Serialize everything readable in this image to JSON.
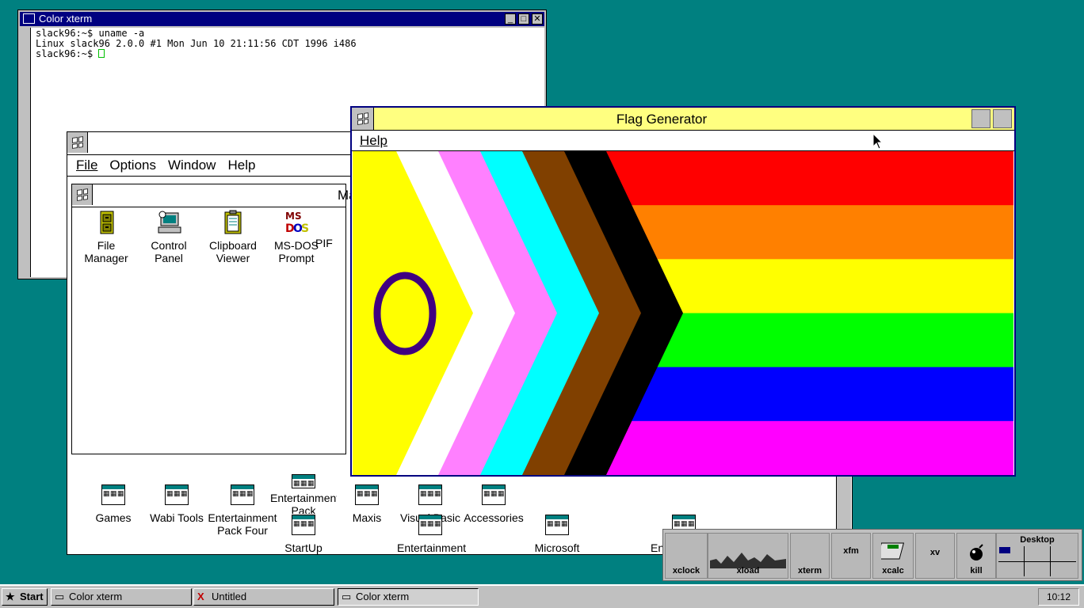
{
  "xterm": {
    "title": "Color xterm",
    "lines": [
      "slack96:~$ uname -a",
      "Linux slack96 2.0.0 #1 Mon Jun 10 21:11:56 CDT 1996 i486"
    ],
    "prompt": "slack96:~$ "
  },
  "progman": {
    "menu": {
      "file": "File",
      "options": "Options",
      "window": "Window",
      "help": "Help"
    },
    "main_title": "Ma",
    "main_icons": [
      {
        "label1": "File",
        "label2": "Manager"
      },
      {
        "label1": "Control",
        "label2": "Panel"
      },
      {
        "label1": "Clipboard",
        "label2": "Viewer"
      },
      {
        "label1": "MS-DOS",
        "label2": "Prompt"
      },
      {
        "label1": "PIF",
        "label2": ""
      }
    ],
    "groups": [
      "Games",
      "Wabi Tools",
      "Entertainment Pack Four",
      "Entertainment Pack",
      "Maxis",
      "Visual Basic",
      "Accessories",
      "StartUp",
      "Entertainment",
      "Microsoft",
      "Entertainment"
    ]
  },
  "flag": {
    "title": "Flag Generator",
    "menu_help": "Help",
    "stripes": [
      "#ff0000",
      "#ff8000",
      "#ffff00",
      "#00ff00",
      "#0000ff",
      "#ff00ff"
    ],
    "chevrons": [
      "#000000",
      "#804000",
      "#00ffff",
      "#ff80ff",
      "#ffffff",
      "#ffff00"
    ],
    "circle_color": "#400080"
  },
  "dock": {
    "xclock": "xclock",
    "xload": "xload",
    "xterm": "xterm",
    "xfm": "xfm",
    "xcalc": "xcalc",
    "xv": "xv",
    "kill": "kill",
    "desktop": "Desktop"
  },
  "taskbar": {
    "start": "Start",
    "tasks": [
      "Color xterm",
      "Untitled",
      "Color xterm"
    ],
    "clock": "10:12"
  }
}
